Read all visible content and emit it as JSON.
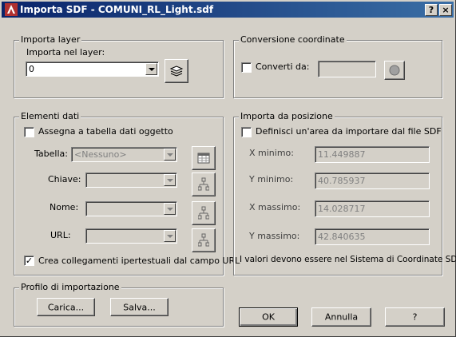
{
  "window": {
    "title": "Importa SDF - COMUNI_RL_Light.sdf",
    "help_btn": "?",
    "close_btn": "×",
    "app_icon": "autocad-icon"
  },
  "import_layer": {
    "group_label": "Importa layer",
    "field_label": "Importa nel layer:",
    "selected_value": "0",
    "layer_button_icon": "layers-icon"
  },
  "coord_conversion": {
    "group_label": "Conversione coordinate",
    "checkbox_label": "Converti da:",
    "checked": false,
    "value": "",
    "button_icon": "globe-icon"
  },
  "data_elements": {
    "group_label": "Elementi dati",
    "assign_label": "Assegna a tabella dati oggetto",
    "assign_checked": false,
    "table_label": "Tabella:",
    "table_value": "<Nessuno>",
    "key_label": "Chiave:",
    "key_value": "",
    "name_label": "Nome:",
    "name_value": "",
    "url_label": "URL:",
    "url_value": "",
    "hyperlink_label": "Crea collegamenti ipertestuali dal campo URL",
    "hyperlink_checked": true,
    "table_button_icon": "table-icon",
    "key_button_icon": "hierarchy-icon",
    "name_button_icon": "hierarchy-icon",
    "url_button_icon": "hierarchy-icon"
  },
  "import_from_position": {
    "group_label": "Importa da posizione",
    "checkbox_label": "Definisci un'area da importare dal file SDF",
    "checked": false,
    "x_min_label": "X minimo:",
    "x_min_value": "11.449887",
    "y_min_label": "Y minimo:",
    "y_min_value": "40.785937",
    "x_max_label": "X massimo:",
    "x_max_value": "14.028717",
    "y_max_label": "Y massimo:",
    "y_max_value": "42.840635",
    "note": "I valori devono essere nel Sistema di Coordinate SDF"
  },
  "profile": {
    "group_label": "Profilo di importazione",
    "load_label": "Carica...",
    "save_label": "Salva..."
  },
  "footer": {
    "ok_label": "OK",
    "cancel_label": "Annulla",
    "help_label": "?"
  }
}
